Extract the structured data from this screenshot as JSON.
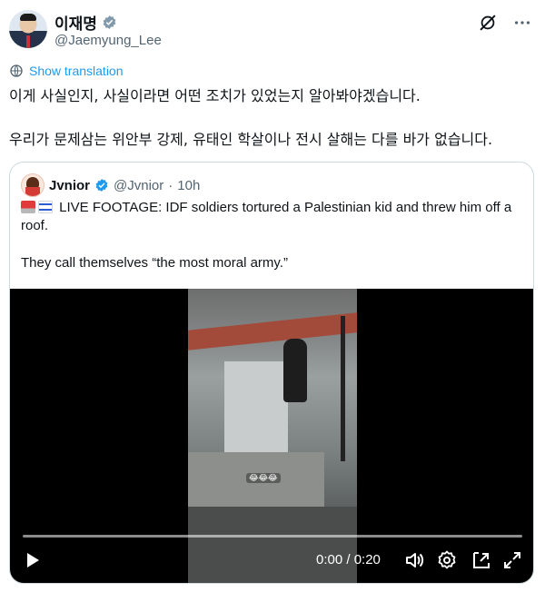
{
  "colors": {
    "accent": "#1d9bf0",
    "text": "#0f1419",
    "secondary": "#536471",
    "verified": "#829aab",
    "border": "#cfd9de"
  },
  "author": {
    "display_name": "이재명",
    "handle": "@Jaemyung_Lee",
    "verified_icon": "verified-badge-icon",
    "avatar": "avatar"
  },
  "header_actions": [
    "grok-icon",
    "more-icon"
  ],
  "translation": {
    "icon": "globe-icon",
    "label": "Show translation"
  },
  "tweet": {
    "line1": "이게 사실인지, 사실이라면 어떤 조치가 있었는지 알아봐야겠습니다.",
    "line2": "우리가 문제삼는 위안부 강제, 유태인 학살이나 전시 살해는 다를 바가 없습니다."
  },
  "quote": {
    "display_name": "Jvnior",
    "handle": "@Jvnior",
    "separator": "·",
    "time": "10h",
    "line1": "LIVE FOOTAGE: IDF soldiers tortured a Palestinian kid and threw him off a roof.",
    "line2": "They call themselves “the most moral army.”",
    "video": {
      "time": "0:00 / 0:20",
      "progress": 0,
      "controls": [
        "play-icon",
        "volume-icon",
        "settings-icon",
        "pip-icon",
        "fullscreen-icon"
      ]
    }
  }
}
